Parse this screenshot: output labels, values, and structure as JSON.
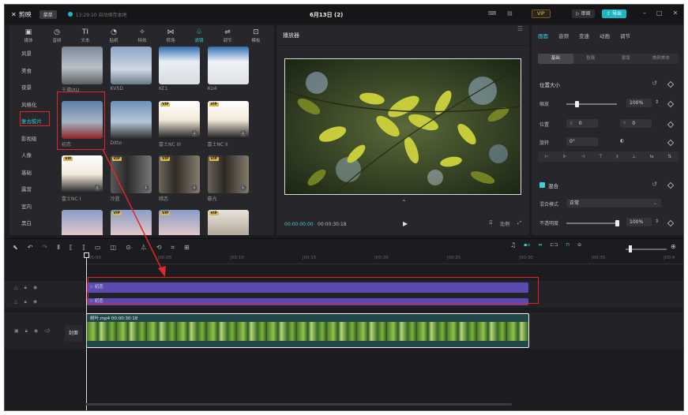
{
  "titlebar": {
    "app_name": "剪映",
    "menu_label": "菜单",
    "autosave_text": "13:29:10 自动保存本地",
    "project_title": "6月13日 (2)",
    "vip_label": "VIP",
    "review_label": "审阅",
    "export_label": "导出",
    "minimize": "–",
    "maximize": "□",
    "close": "✕"
  },
  "library": {
    "tabs": [
      {
        "icon": "▣",
        "label": "媒体"
      },
      {
        "icon": "◷",
        "label": "音频"
      },
      {
        "icon": "TI",
        "label": "文本"
      },
      {
        "icon": "◔",
        "label": "贴纸"
      },
      {
        "icon": "✧",
        "label": "特效"
      },
      {
        "icon": "⋈",
        "label": "转场"
      },
      {
        "icon": "♧",
        "label": "滤镜"
      },
      {
        "icon": "⇌",
        "label": "调节"
      },
      {
        "icon": "⊡",
        "label": "模板"
      }
    ],
    "active_tab": "滤镜",
    "categories": [
      "风景",
      "美食",
      "夜景",
      "风格化",
      "复古胶片",
      "影视级",
      "人像",
      "基础",
      "露营",
      "室内",
      "黑白"
    ],
    "active_category": "复古胶片",
    "filters": [
      {
        "label": "千禧IXU",
        "vip": false,
        "download": false
      },
      {
        "label": "KV5D",
        "vip": false,
        "download": false
      },
      {
        "label": "KE1",
        "vip": false,
        "download": false
      },
      {
        "label": "KU4",
        "vip": false,
        "download": false
      },
      {
        "label": "初恋",
        "vip": false,
        "download": false
      },
      {
        "label": "Ditto",
        "vip": false,
        "download": false
      },
      {
        "label": "富士NC III",
        "vip": true,
        "download": true
      },
      {
        "label": "富士NC II",
        "vip": true,
        "download": true
      },
      {
        "label": "富士NC I",
        "vip": true,
        "download": true
      },
      {
        "label": "冷蓝",
        "vip": true,
        "download": true
      },
      {
        "label": "暗恋",
        "vip": true,
        "download": true
      },
      {
        "label": "暮光",
        "vip": true,
        "download": true
      },
      {
        "label": "",
        "vip": false,
        "download": false
      },
      {
        "label": "",
        "vip": true,
        "download": false
      },
      {
        "label": "",
        "vip": true,
        "download": false
      },
      {
        "label": "",
        "vip": true,
        "download": false
      }
    ]
  },
  "player": {
    "title": "播放器",
    "current_time": "00:00:00:00",
    "total_time": "00:00:30:18",
    "ratio_label": "比例"
  },
  "props": {
    "tabs": [
      "画面",
      "音频",
      "变速",
      "动画",
      "调节"
    ],
    "active_tab": "画面",
    "sub_tabs": [
      "基础",
      "抠像",
      "蒙版",
      "美颜美体"
    ],
    "active_sub_tab": "基础",
    "position_size_label": "位置大小",
    "scale_label": "缩放",
    "scale_value": "100%",
    "scale_fraction": 0.2,
    "position_label": "位置",
    "pos_x_label": "X",
    "pos_x_value": "0",
    "pos_y_label": "Y",
    "pos_y_value": "0",
    "rotate_label": "旋转",
    "rotate_value": "0°",
    "blend_label": "混合",
    "blend_mode_label": "混合模式",
    "blend_mode_value": "正常",
    "opacity_label": "不透明度",
    "opacity_value": "100%",
    "opacity_fraction": 1.0
  },
  "timeline": {
    "ruler_ticks": [
      "00:00",
      "|00:05",
      "|00:10",
      "|00:15",
      "|00:20",
      "|00:25",
      "|00:30",
      "|00:35",
      "|00:4"
    ],
    "effect_track_1_label": "初恋",
    "effect_track_2_label": "初恋",
    "clip_label": "树叶.mp4  00:00:30:18",
    "cover_label": "封面"
  },
  "colors": {
    "accent": "#3ad0d8",
    "annotation_red": "#e0262a",
    "filter_track": "#5b4bb0",
    "clip_border": "#eeeeee"
  }
}
